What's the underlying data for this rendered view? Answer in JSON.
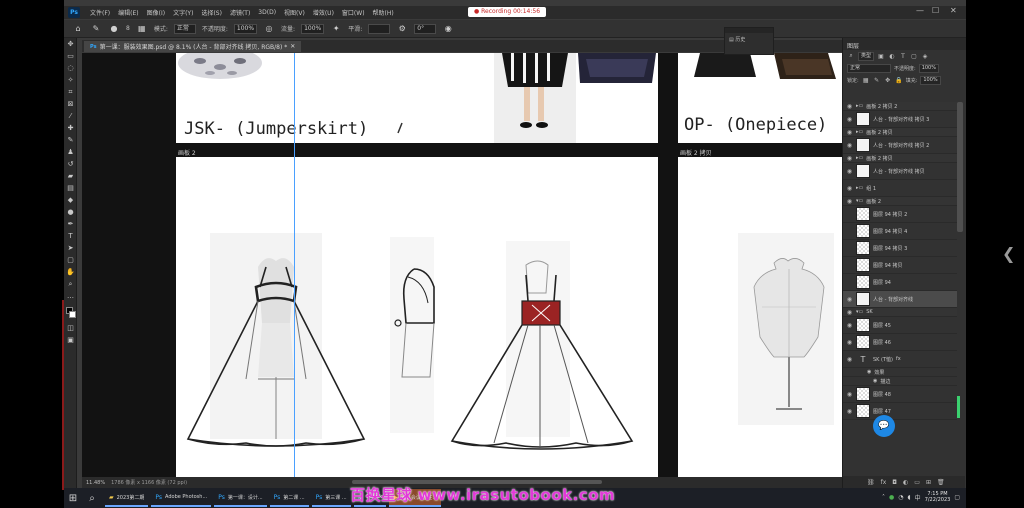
{
  "menubar": {
    "logo": "Ps",
    "items": [
      "文件(F)",
      "编辑(E)",
      "图像(I)",
      "文字(Y)",
      "选择(S)",
      "滤镜(T)",
      "3D(D)",
      "视图(V)",
      "增效(U)",
      "窗口(W)",
      "帮助(H)"
    ],
    "recording": "Recording 00:14:56"
  },
  "options": {
    "brush_size": "8",
    "mode_label": "模式:",
    "mode_value": "正常",
    "opacity_label": "不透明度:",
    "opacity_value": "100%",
    "flow_label": "流量:",
    "flow_value": "100%",
    "smooth_label": "平滑:",
    "angle_value": "0°"
  },
  "document": {
    "tab_label": "第一课：服装效果图.psd @ 8.1% (人台 - 背部对齐线 拷贝, RGB/8) *",
    "zoom": "11.48%",
    "status_info": "1786 像素 x 1166 像素 (72 ppi)"
  },
  "canvas": {
    "jsk_title": "JSK- (Jumperskirt)",
    "op_title": "OP- (Onepiece)",
    "artboard2_label": "画板 2",
    "artboard2copy_label": "画板 2 拷贝"
  },
  "mini_panel": {
    "row": "历史"
  },
  "right_panel": {
    "header": "图层",
    "filter_value": "类型",
    "blend_value": "正常",
    "opacity_label": "不透明度:",
    "opacity_value": "100%",
    "lock_label": "锁定:",
    "fill_label": "填充:",
    "fill_value": "100%",
    "layers": [
      {
        "name": "画板 2 拷贝 2",
        "kind": "group"
      },
      {
        "name": "人台 - 背部对齐线 拷贝 3",
        "kind": "layer"
      },
      {
        "name": "画板 2 拷贝",
        "kind": "group"
      },
      {
        "name": "人台 - 背部对齐线 拷贝 2",
        "kind": "layer"
      },
      {
        "name": "画板 2 拷贝",
        "kind": "group"
      },
      {
        "name": "人台 - 背部对齐线 拷贝",
        "kind": "layer"
      },
      {
        "name": "组 1",
        "kind": "layer"
      },
      {
        "name": "画板 2",
        "kind": "group"
      },
      {
        "name": "图层 94 拷贝 2",
        "kind": "layer"
      },
      {
        "name": "图层 94 拷贝 4",
        "kind": "layer"
      },
      {
        "name": "图层 94 拷贝 3",
        "kind": "layer"
      },
      {
        "name": "图层 94 拷贝",
        "kind": "layer"
      },
      {
        "name": "图层 94",
        "kind": "layer"
      },
      {
        "name": "人台 - 背部对齐线",
        "kind": "active"
      },
      {
        "name": "SK",
        "kind": "group"
      },
      {
        "name": "图层 45",
        "kind": "layer"
      },
      {
        "name": "图层 46",
        "kind": "layer"
      },
      {
        "name": "SK (T恤)",
        "kind": "text"
      },
      {
        "name": "效果",
        "kind": "sub"
      },
      {
        "name": "描边",
        "kind": "sub"
      },
      {
        "name": "图层 48",
        "kind": "layer"
      },
      {
        "name": "图层 47",
        "kind": "layer"
      }
    ]
  },
  "taskbar": {
    "items": [
      {
        "label": "2023第二期",
        "icon": "folder-icon"
      },
      {
        "label": "Adobe Photosh...",
        "icon": "photoshop-icon"
      },
      {
        "label": "第一课：设计...",
        "icon": "photoshop-icon"
      },
      {
        "label": "第二课 ...",
        "icon": "photoshop-icon"
      },
      {
        "label": "第三课 ...",
        "icon": "photoshop-icon"
      },
      {
        "label": "CCtalk",
        "icon": "cctalk-icon"
      },
      {
        "label": "腾讯会议 正在...",
        "icon": "meeting-icon"
      }
    ],
    "time": "7:15 PM",
    "date": "7/22/2023"
  },
  "watermark": "百换星球 www.irasutobook.com"
}
